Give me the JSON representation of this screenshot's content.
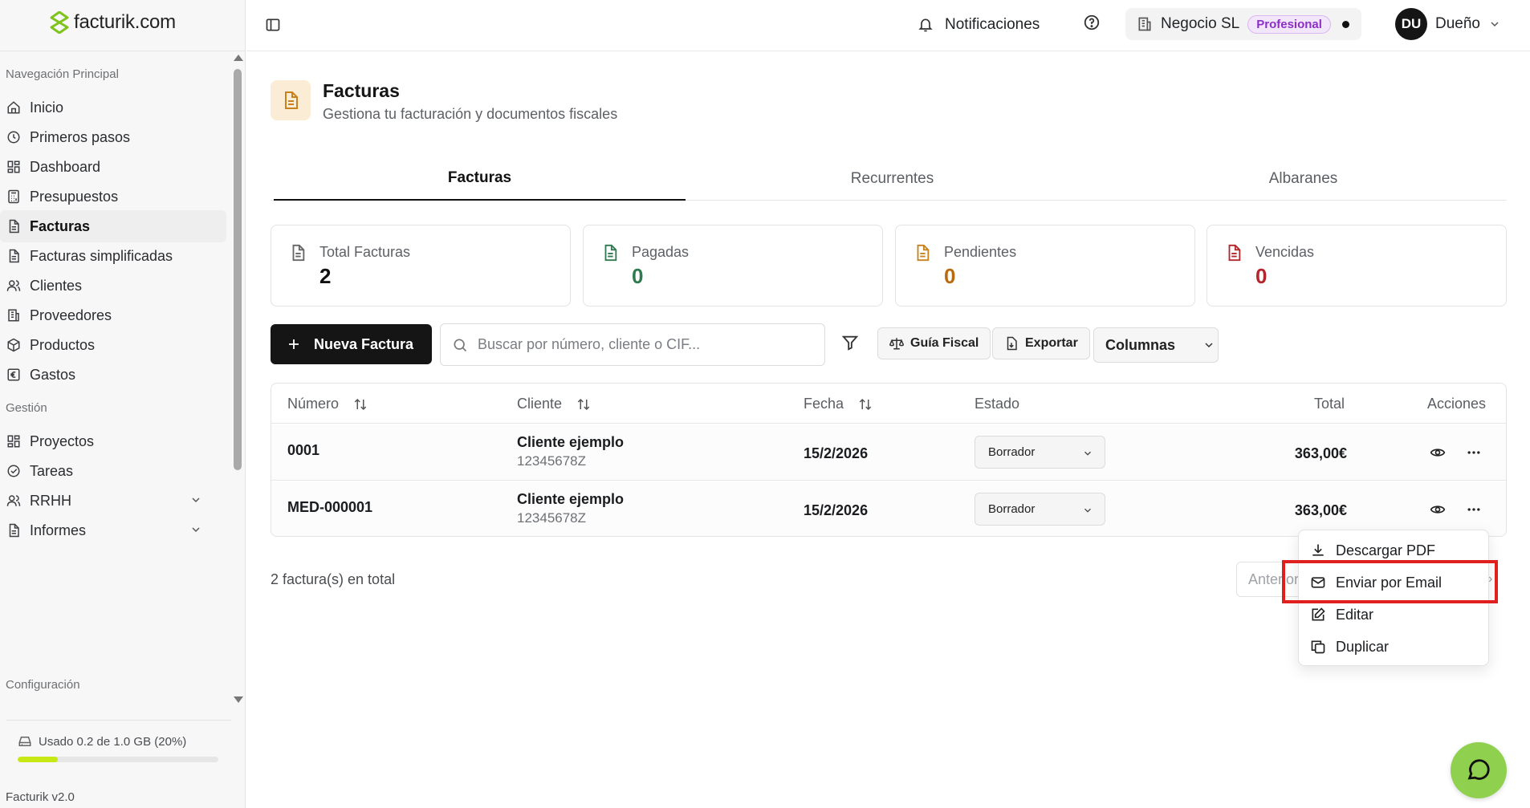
{
  "app": {
    "logo_text": "facturik.com",
    "version": "Facturik v2.0"
  },
  "sidebar": {
    "sections": {
      "main": "Navegación Principal",
      "gestion": "Gestión",
      "config": "Configuración"
    },
    "main_items": [
      {
        "label": "Inicio",
        "icon": "home-icon"
      },
      {
        "label": "Primeros pasos",
        "icon": "clock-icon"
      },
      {
        "label": "Dashboard",
        "icon": "dashboard-icon"
      },
      {
        "label": "Presupuestos",
        "icon": "calculator-icon"
      },
      {
        "label": "Facturas",
        "icon": "file-text-icon",
        "active": true
      },
      {
        "label": "Facturas simplificadas",
        "icon": "file-text-icon"
      },
      {
        "label": "Clientes",
        "icon": "users-icon"
      },
      {
        "label": "Proveedores",
        "icon": "building-icon"
      },
      {
        "label": "Productos",
        "icon": "package-icon"
      },
      {
        "label": "Gastos",
        "icon": "euro-icon"
      }
    ],
    "gestion_items": [
      {
        "label": "Proyectos",
        "icon": "dashboard-icon"
      },
      {
        "label": "Tareas",
        "icon": "check-circle-icon"
      },
      {
        "label": "RRHH",
        "icon": "users-icon",
        "expandable": true
      },
      {
        "label": "Informes",
        "icon": "file-text-icon",
        "expandable": true
      }
    ],
    "storage": {
      "label": "Usado 0.2 de 1.0 GB (20%)",
      "fraction": 0.2,
      "bar_color": "#c8e815"
    }
  },
  "topbar": {
    "notifications_label": "Notificaciones",
    "business_name": "Negocio SL",
    "plan_badge": "Profesional",
    "user_initials": "DU",
    "user_name": "Dueño"
  },
  "page": {
    "title": "Facturas",
    "subtitle": "Gestiona tu facturación y documentos fiscales",
    "accent_color": "#c8811d"
  },
  "tabs": [
    {
      "label": "Facturas",
      "active": true
    },
    {
      "label": "Recurrentes"
    },
    {
      "label": "Albaranes"
    }
  ],
  "stats": [
    {
      "label": "Total Facturas",
      "value": "2",
      "color": "#111111"
    },
    {
      "label": "Pagadas",
      "value": "0",
      "color": "#2f7a4f"
    },
    {
      "label": "Pendientes",
      "value": "0",
      "color": "#b86a10"
    },
    {
      "label": "Vencidas",
      "value": "0",
      "color": "#b3262b"
    }
  ],
  "toolbar": {
    "new_invoice": "Nueva Factura",
    "search_placeholder": "Buscar por número, cliente o CIF...",
    "fiscal_guide": "Guía Fiscal",
    "export": "Exportar",
    "columns": "Columnas"
  },
  "table": {
    "headers": {
      "number": "Número",
      "client": "Cliente",
      "date": "Fecha",
      "state": "Estado",
      "total": "Total",
      "actions": "Acciones"
    },
    "rows": [
      {
        "number": "0001",
        "client": "Cliente ejemplo",
        "client_id": "12345678Z",
        "date": "15/2/2026",
        "state": "Borrador",
        "total": "363,00€"
      },
      {
        "number": "MED-000001",
        "client": "Cliente ejemplo",
        "client_id": "12345678Z",
        "date": "15/2/2026",
        "state": "Borrador",
        "total": "363,00€"
      }
    ]
  },
  "footer": {
    "count": "2 factura(s) en total",
    "prev": "Anterior"
  },
  "dropdown": {
    "items": [
      {
        "label": "Descargar PDF",
        "icon": "download-icon"
      },
      {
        "label": "Enviar por Email",
        "icon": "mail-icon",
        "highlighted": true
      },
      {
        "label": "Editar",
        "icon": "edit-icon"
      },
      {
        "label": "Duplicar",
        "icon": "copy-icon"
      }
    ],
    "highlight_color": "#e01f1f"
  },
  "chat": {
    "icon": "chat-bubble-icon",
    "color": "#8fd14f"
  }
}
